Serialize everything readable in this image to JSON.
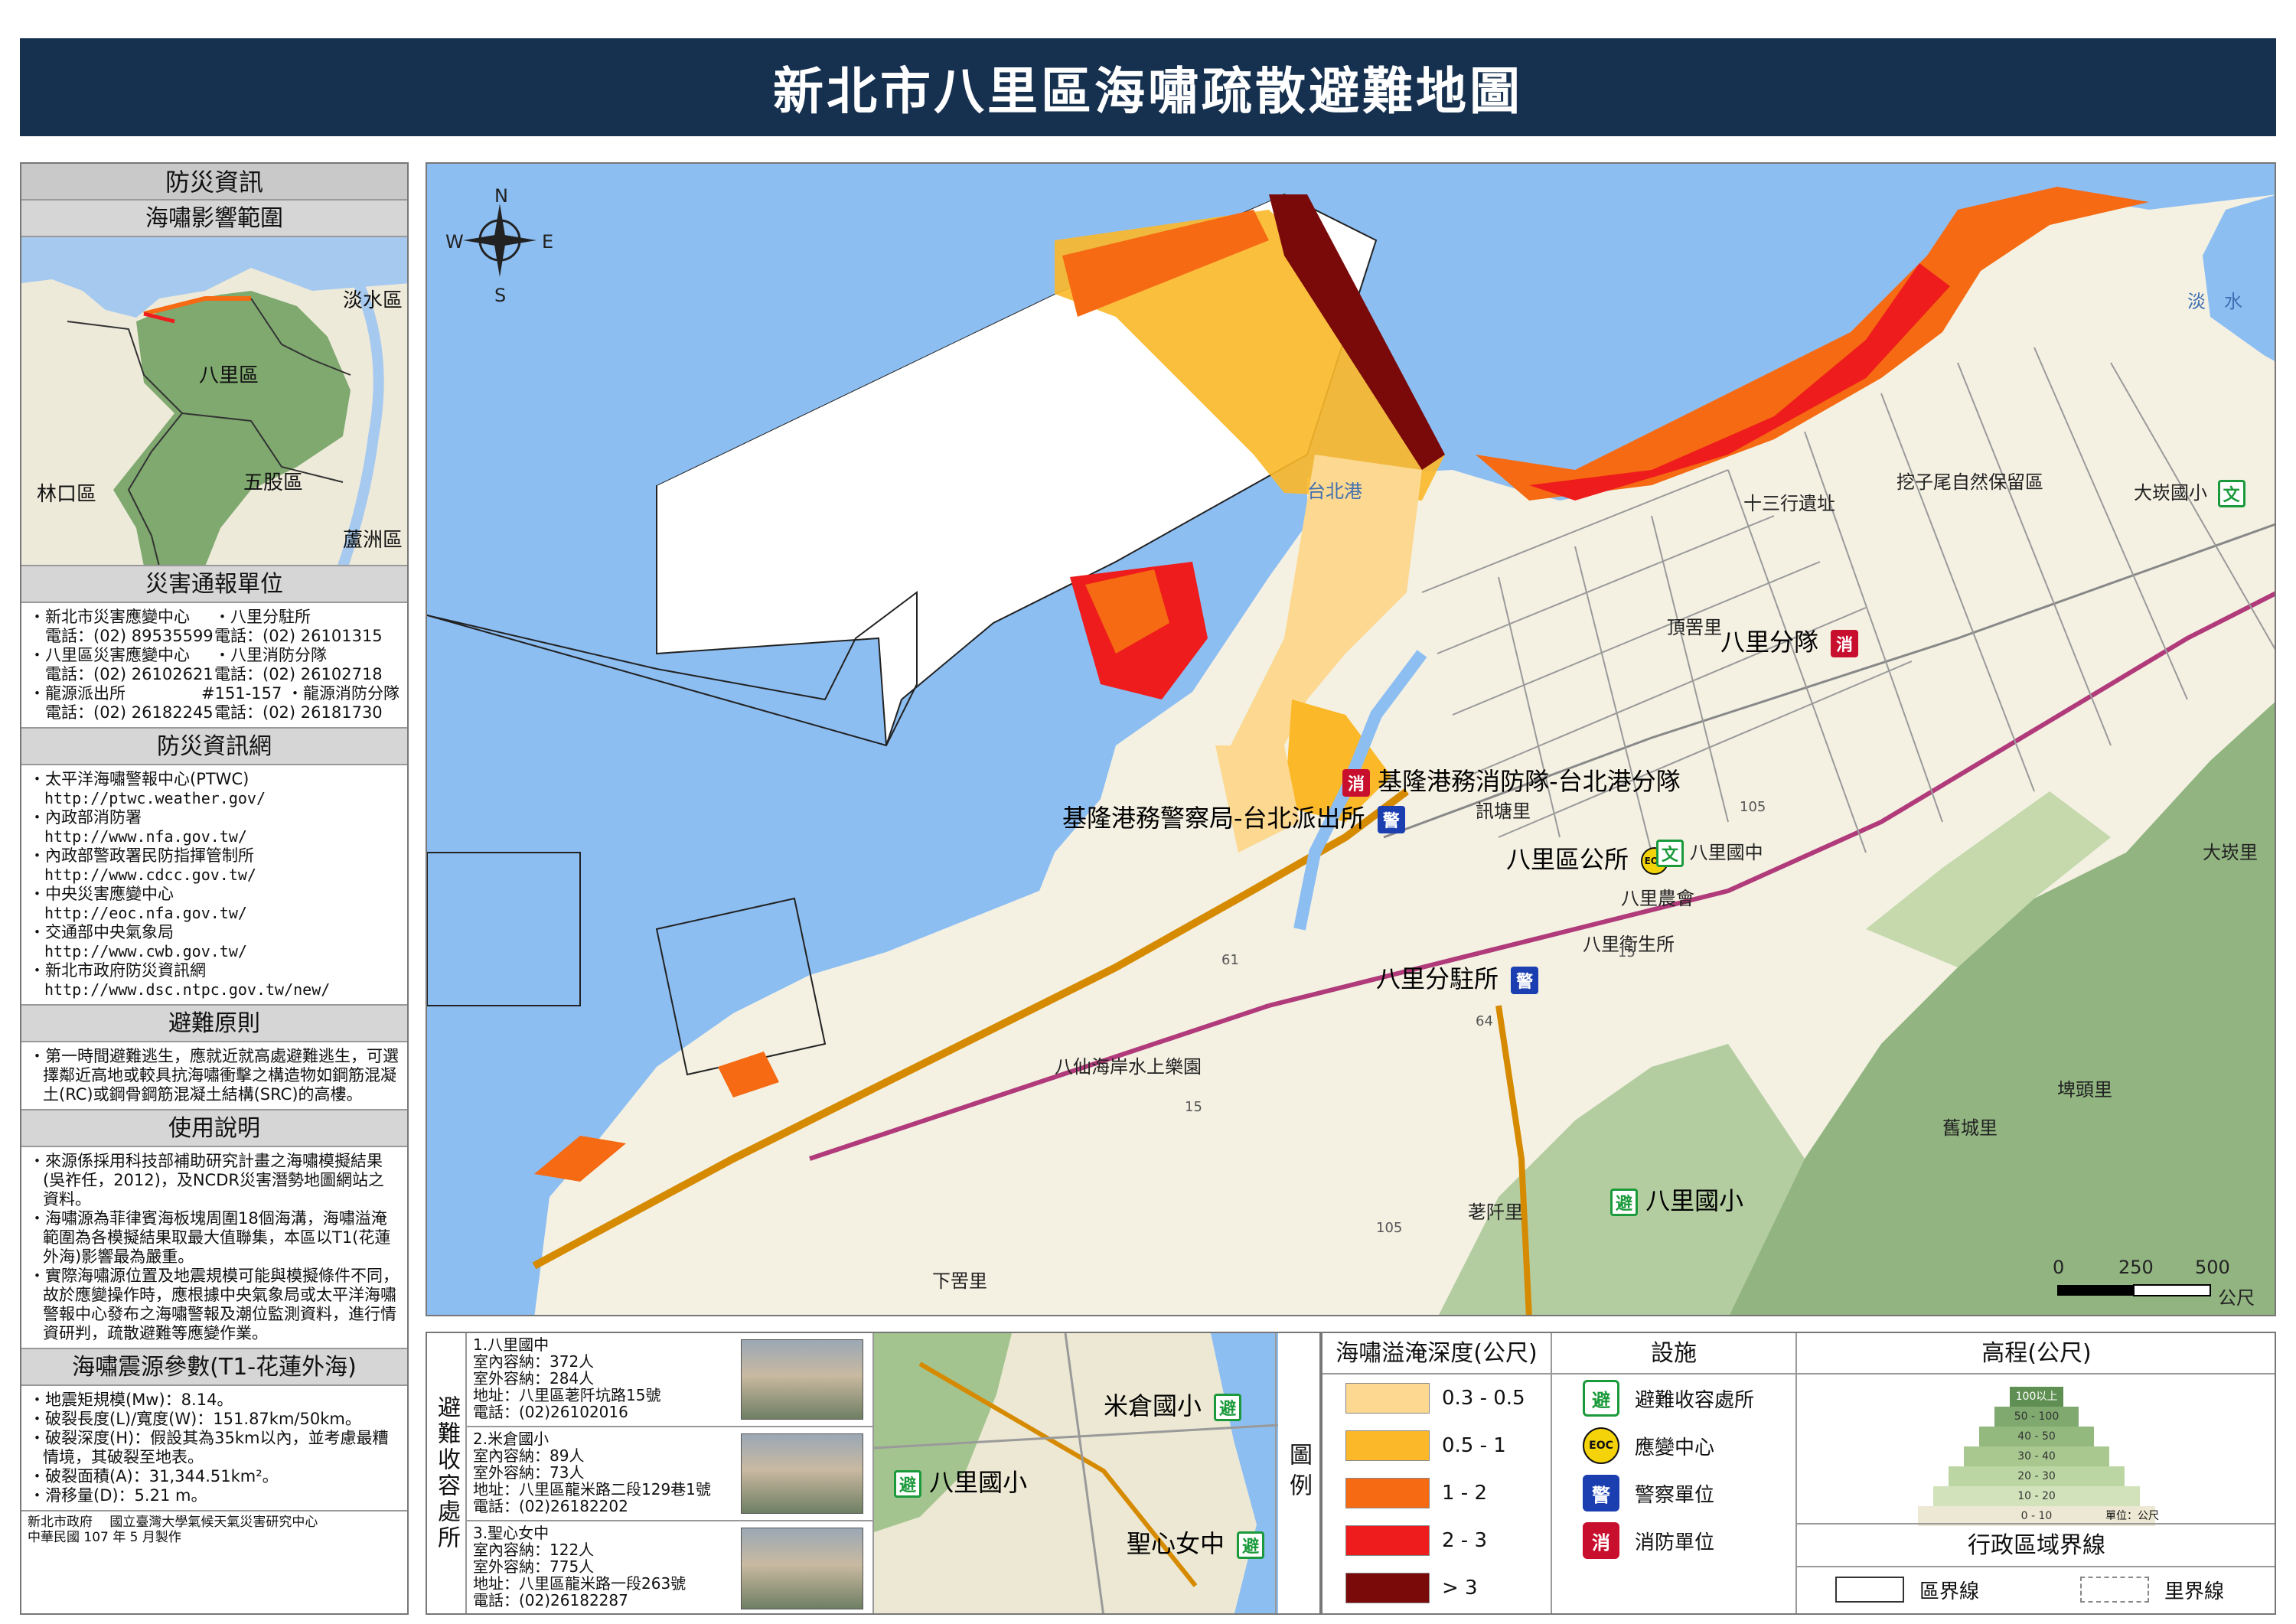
{
  "title": "新北市八里區海嘯疏散避難地圖",
  "left_panel": {
    "disaster_info_head": "防災資訊",
    "impact_head": "海嘯影響範圍",
    "inset_labels": [
      "淡水區",
      "八里區",
      "林口區",
      "五股區",
      "蘆洲區"
    ],
    "report_head": "災害通報單位",
    "report_rows": [
      [
        "・新北市災害應變中心",
        "・八里分駐所"
      ],
      [
        "　電話：(02) 89535599",
        "電話：(02) 26101315"
      ],
      [
        "・八里區災害應變中心",
        "・八里消防分隊"
      ],
      [
        "　電話：(02) 26102621",
        "電話：(02) 26102718"
      ],
      [
        "・龍源派出所",
        "#151-157 ・龍源消防分隊"
      ],
      [
        "　電話：(02) 26182245",
        "電話：(02) 26181730"
      ]
    ],
    "web_head": "防災資訊網",
    "web_items": [
      "・太平洋海嘯警報中心(PTWC)",
      "　http://ptwc.weather.gov/",
      "・內政部消防署",
      "　http://www.nfa.gov.tw/",
      "・內政部警政署民防指揮管制所",
      "　http://www.cdcc.gov.tw/",
      "・中央災害應變中心",
      "　http://eoc.nfa.gov.tw/",
      "・交通部中央氣象局",
      "　http://www.cwb.gov.tw/",
      "・新北市政府防災資訊網",
      "　http://www.dsc.ntpc.gov.tw/new/"
    ],
    "principle_head": "避難原則",
    "principle_text": "・第一時間避難逃生，應就近就高處避難逃生，可選擇鄰近高地或較具抗海嘯衝擊之構造物如鋼筋混凝土(RC)或鋼骨鋼筋混凝土結構(SRC)的高樓。",
    "usage_head": "使用說明",
    "usage_items": [
      "・來源係採用科技部補助研究計畫之海嘯模擬結果(吳祚任，2012)，及NCDR災害潛勢地圖網站之資料。",
      "・海嘯源為菲律賓海板塊周圍18個海溝，海嘯溢淹範圍為各模擬結果取最大值聯集，本區以T1(花蓮外海)影響最為嚴重。",
      "・實際海嘯源位置及地震規模可能與模擬條件不同，故於應變操作時，應根據中央氣象局或太平洋海嘯警報中心發布之海嘯警報及潮位監測資料，進行情資研判，疏散避難等應變作業。"
    ],
    "source_head": "海嘯震源參數(T1-花蓮外海)",
    "source_items": [
      "・地震矩規模(Mw)：8.14。",
      "・破裂長度(L)/寬度(W)：151.87km/50km。",
      "・破裂深度(H)：假設其為35km以內，並考慮最糟情境，其破裂至地表。",
      "・破裂面積(A)：31,344.51km²。",
      "・滑移量(D)：5.21 m。"
    ],
    "credit_line1": "新北市政府　 國立臺灣大學氣候天氣災害研究中心",
    "credit_line2": "中華民國 107 年 5 月製作"
  },
  "main_map": {
    "compass": {
      "n": "N",
      "s": "S",
      "e": "E",
      "w": "W"
    },
    "labels": {
      "harbor": "台北港",
      "danshui_river": "淡　水",
      "fire_keelung": "基隆港務消防隊-台北港分隊",
      "police_keelung": "基隆港務警察局-台北派出所",
      "fire_bali": "八里分隊",
      "district_office": "八里區公所",
      "bali_junior": "八里國中",
      "farmers": "八里農會",
      "health": "八里衛生所",
      "police_bali": "八里分駐所",
      "water_park": "八仙海岸水上樂園",
      "bali_elem": "八里國小",
      "dakan_elem": "大崁國小",
      "thirteen": "十三行遺址",
      "wazi": "挖子尾自然保留區",
      "dingpu": "頂罟里",
      "xunsha": "訊塘里",
      "dakan": "大崁里",
      "bitou": "埤頭里",
      "jiucheng": "舊城里",
      "zhengqian": "荖阡里",
      "xiagu": "下罟里",
      "road15a": "15",
      "road15b": "15",
      "road61": "61",
      "road64": "64",
      "road105a": "105",
      "road105b": "105"
    },
    "scale": {
      "t0": "0",
      "t250": "250",
      "t500": "500",
      "unit": "公尺"
    }
  },
  "shelters": {
    "title": "避難收容處所",
    "items": [
      {
        "name": "1.八里國中",
        "indoor": "室內容納：372人",
        "outdoor": "室外容納：284人",
        "addr": "地址：八里區荖阡坑路15號",
        "tel": "電話：(02)26102016"
      },
      {
        "name": "2.米倉國小",
        "indoor": "室內容納：89人",
        "outdoor": "室外容納：73人",
        "addr": "地址：八里區龍米路二段129巷1號",
        "tel": "電話：(02)26182202"
      },
      {
        "name": "3.聖心女中",
        "indoor": "室內容納：122人",
        "outdoor": "室外容納：775人",
        "addr": "地址：八里區龍米路一段263號",
        "tel": "電話：(02)26182287"
      }
    ],
    "mini_labels": [
      "米倉國小",
      "八里國小",
      "聖心女中"
    ],
    "legend_tab": "圖例"
  },
  "legend": {
    "depth_head": "海嘯溢淹深度(公尺)",
    "depth_rows": [
      {
        "label": "0.3 - 0.5",
        "color": "#fcd890"
      },
      {
        "label": "0.5 - 1",
        "color": "#fbb829"
      },
      {
        "label": "1 - 2",
        "color": "#f56a12"
      },
      {
        "label": "2 - 3",
        "color": "#ee1c1c"
      },
      {
        "label": "> 3",
        "color": "#7a0a0a"
      }
    ],
    "facility_head": "設施",
    "facility_rows": [
      "避難收容處所",
      "應變中心",
      "警察單位",
      "消防單位"
    ],
    "elev_head": "高程(公尺)",
    "elev_tiers": [
      "100以上",
      "50 - 100",
      "40 - 50",
      "30 - 40",
      "20 - 30",
      "10 - 20",
      "0 - 10"
    ],
    "elev_unit": "單位：公尺",
    "boundary_head": "行政區域界線",
    "district_line": "區界線",
    "village_line": "里界線",
    "colors": {
      "sea": "#8dbef2",
      "land": "#f4f1e3",
      "mountain": "#7fa96f",
      "title_bg": "#16304f"
    }
  }
}
